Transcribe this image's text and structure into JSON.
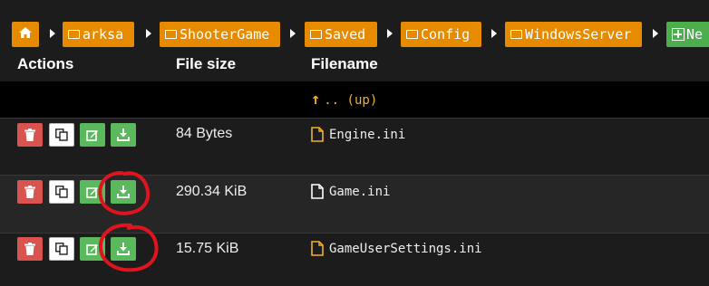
{
  "breadcrumb": {
    "home_icon": "home-icon",
    "items": [
      "arksa",
      "ShooterGame",
      "Saved",
      "Config",
      "WindowsServer"
    ],
    "new_label": "Ne"
  },
  "table": {
    "headers": {
      "actions": "Actions",
      "size": "File size",
      "filename": "Filename"
    },
    "up_label": ".. (up)",
    "rows": [
      {
        "size": "84 Bytes",
        "name": "Engine.ini",
        "icon": "file-icon-yellow"
      },
      {
        "size": "290.34 KiB",
        "name": "Game.ini",
        "icon": "file-icon-white"
      },
      {
        "size": "15.75 KiB",
        "name": "GameUserSettings.ini",
        "icon": "file-icon-yellow"
      }
    ]
  },
  "colors": {
    "crumb": "#e68a00",
    "new": "#4cae4c",
    "delete": "#d9534f",
    "edit": "#5cb85c",
    "annotation": "#e0141e"
  }
}
